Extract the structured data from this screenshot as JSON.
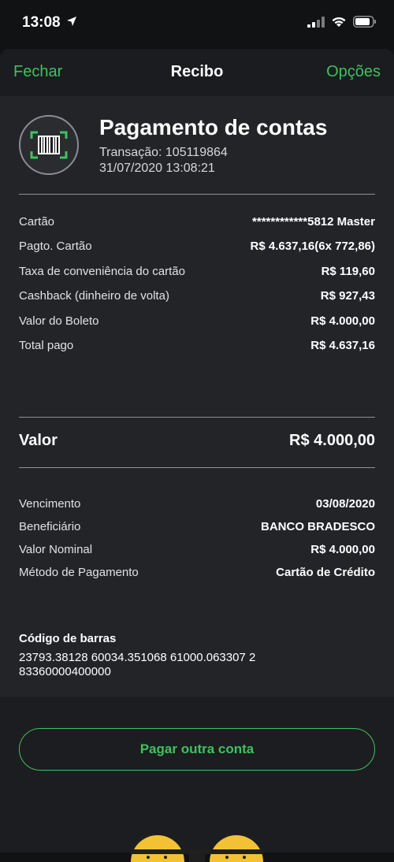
{
  "status_bar": {
    "time": "13:08"
  },
  "navbar": {
    "left": "Fechar",
    "title": "Recibo",
    "right": "Opções"
  },
  "header": {
    "title": "Pagamento de contas",
    "transaction": "Transação: 105119864",
    "datetime": "31/07/2020 13:08:21",
    "icon": "barcode-icon"
  },
  "payment_details": [
    {
      "label": "Cartão",
      "value": "************5812 Master"
    },
    {
      "label": "Pagto. Cartão",
      "value": "R$ 4.637,16(6x 772,86)"
    },
    {
      "label": "Taxa de conveniência do cartão",
      "value": "R$ 119,60"
    },
    {
      "label": "Cashback (dinheiro de volta)",
      "value": "R$ 927,43"
    },
    {
      "label": "Valor do Boleto",
      "value": "R$ 4.000,00"
    },
    {
      "label": "Total pago",
      "value": "R$ 4.637,16"
    }
  ],
  "valor": {
    "label": "Valor",
    "value": "R$ 4.000,00"
  },
  "boleto_details": [
    {
      "label": "Vencimento",
      "value": "03/08/2020"
    },
    {
      "label": "Beneficiário",
      "value": "BANCO BRADESCO"
    },
    {
      "label": "Valor Nominal",
      "value": "R$ 4.000,00"
    },
    {
      "label": "Método de Pagamento",
      "value": "Cartão de Crédito"
    }
  ],
  "barcode": {
    "title": "Código de barras",
    "value_line1": "23793.38128 60034.351068 61000.063307 2",
    "value_line2": "83360000400000"
  },
  "actions": {
    "pay_another": "Pagar outra conta"
  },
  "colors": {
    "accent": "#3ec25e",
    "background": "#222428"
  }
}
